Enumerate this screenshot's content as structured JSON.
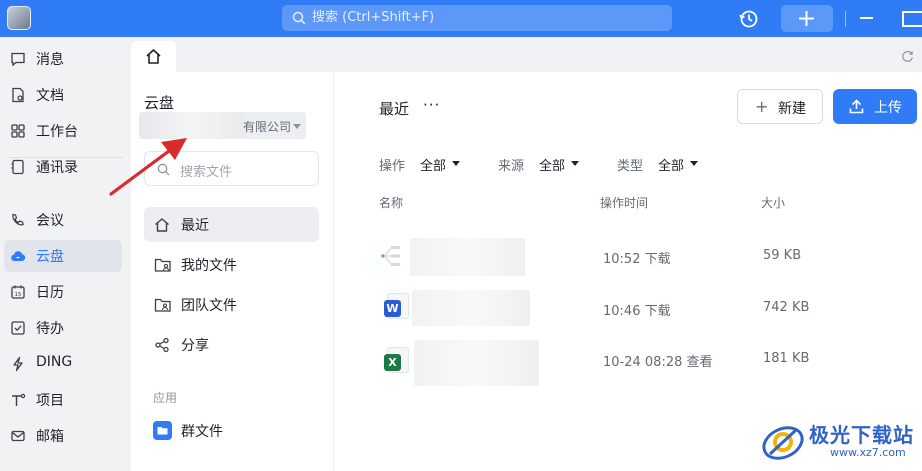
{
  "titlebar": {
    "search_placeholder": "搜索 (Ctrl+Shift+F)"
  },
  "nav": {
    "items": [
      {
        "label": "消息",
        "icon": "chat-bubble-icon"
      },
      {
        "label": "文档",
        "icon": "document-icon"
      },
      {
        "label": "工作台",
        "icon": "grid-icon"
      },
      {
        "label": "通讯录",
        "icon": "contacts-icon"
      },
      {
        "label": "会议",
        "icon": "phone-video-icon"
      },
      {
        "label": "云盘",
        "icon": "cloud-icon",
        "active": true
      },
      {
        "label": "日历",
        "icon": "calendar-icon"
      },
      {
        "label": "待办",
        "icon": "checkbox-icon"
      },
      {
        "label": "DING",
        "icon": "lightning-icon"
      },
      {
        "label": "项目",
        "icon": "project-icon"
      },
      {
        "label": "邮箱",
        "icon": "mail-icon"
      }
    ]
  },
  "panel": {
    "title": "云盘",
    "org_suffix": "有限公司",
    "search_placeholder": "搜索文件",
    "items": [
      {
        "label": "最近",
        "icon": "home-icon",
        "active": true
      },
      {
        "label": "我的文件",
        "icon": "folder-user-icon"
      },
      {
        "label": "团队文件",
        "icon": "folder-team-icon"
      },
      {
        "label": "分享",
        "icon": "share-icon"
      }
    ],
    "apps_label": "应用",
    "apps": [
      {
        "label": "群文件",
        "icon": "group-folder-icon"
      }
    ]
  },
  "main": {
    "title": "最近",
    "more": "···",
    "new_label": "新建",
    "upload_label": "上传",
    "filters": [
      {
        "label": "操作",
        "value": "全部"
      },
      {
        "label": "来源",
        "value": "全部"
      },
      {
        "label": "类型",
        "value": "全部"
      }
    ],
    "columns": {
      "name": "名称",
      "time": "操作时间",
      "size": "大小"
    },
    "rows": [
      {
        "type": "mindmap",
        "time": "10:52 下载",
        "size": "59 KB"
      },
      {
        "type": "word",
        "badge": "W",
        "time": "10:46 下载",
        "size": "742 KB"
      },
      {
        "type": "excel",
        "badge": "X",
        "time": "10-24 08:28 查看",
        "size": "181 KB"
      }
    ]
  },
  "watermark": {
    "text": "极光下载站",
    "url": "www.xz7.com"
  },
  "colors": {
    "brand": "#2f7cf6",
    "arrow": "#d92b2b"
  }
}
